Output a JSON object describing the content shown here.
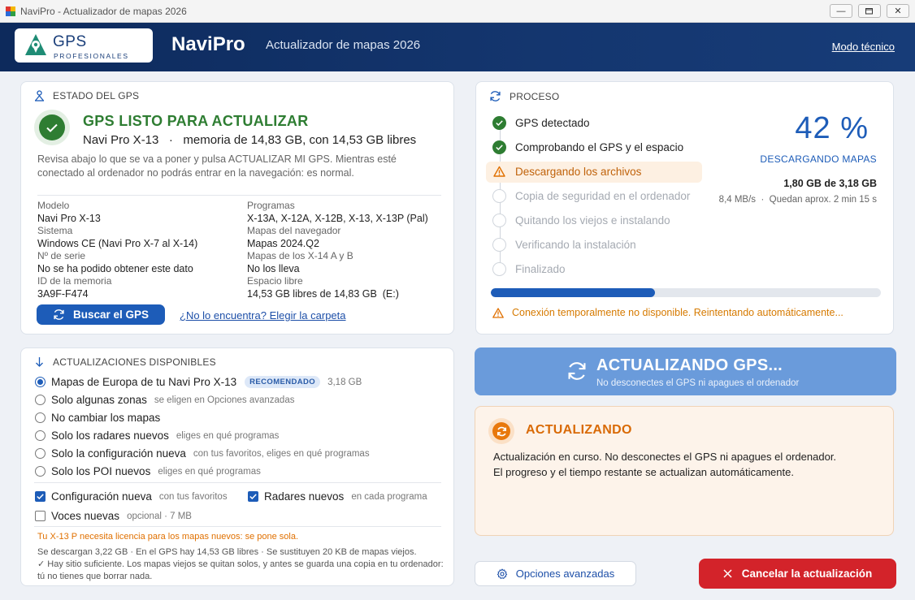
{
  "window": {
    "title": "NaviPro - Actualizador de mapas 2026"
  },
  "header": {
    "logo_main": "GPS",
    "logo_sub": "PROFESIONALES",
    "brand": "NaviPro",
    "subtitle": "Actualizador de mapas 2026",
    "modo_tecnico": "Modo técnico"
  },
  "estado": {
    "heading": "ESTADO DEL GPS",
    "ready_title": "GPS LISTO PARA ACTUALIZAR",
    "ready_sub": "Navi Pro X-13   ·   memoria de 14,83 GB, con 14,53 GB libres",
    "desc": "Revisa abajo lo que se va a poner y pulsa ACTUALIZAR MI GPS. Mientras esté conectado al ordenador no podrás entrar en la navegación: es normal.",
    "specs_left": [
      {
        "label": "Modelo",
        "value": "Navi Pro X-13"
      },
      {
        "label": "Sistema",
        "value": "Windows CE (Navi Pro X-7 al X-14)"
      },
      {
        "label": "Nº de serie",
        "value": "No se ha podido obtener este dato"
      },
      {
        "label": "ID de la memoria",
        "value": "3A9F-F474"
      }
    ],
    "specs_right": [
      {
        "label": "Programas",
        "value": "X-13A, X-12A, X-12B, X-13, X-13P (Pal)"
      },
      {
        "label": "Mapas del navegador",
        "value": "Mapas 2024.Q2"
      },
      {
        "label": "Mapas de los X-14 A y B",
        "value": "No los lleva"
      },
      {
        "label": "Espacio libre",
        "value": "14,53 GB libres de 14,83 GB  (E:)"
      }
    ],
    "search_button": "Buscar el GPS",
    "folder_link": "¿No lo encuentra? Elegir la carpeta"
  },
  "actualizaciones": {
    "heading": "ACTUALIZACIONES DISPONIBLES",
    "options": [
      {
        "label": "Mapas de Europa de tu Navi Pro X-13",
        "badge": "RECOMENDADO",
        "hint": "3,18 GB",
        "selected": true
      },
      {
        "label": "Solo algunas zonas",
        "hint": "se eligen en Opciones avanzadas",
        "selected": false
      },
      {
        "label": "No cambiar los mapas",
        "hint": "",
        "selected": false
      },
      {
        "label": "Solo los radares nuevos",
        "hint": "eliges en qué programas",
        "selected": false
      },
      {
        "label": "Solo la configuración nueva",
        "hint": "con tus favoritos, eliges en qué programas",
        "selected": false
      },
      {
        "label": "Solo los POI nuevos",
        "hint": "eliges en qué programas",
        "selected": false
      }
    ],
    "checks": [
      {
        "label": "Configuración nueva",
        "hint": "con tus favoritos",
        "checked": true
      },
      {
        "label": "Radares nuevos",
        "hint": "en cada programa",
        "checked": true
      },
      {
        "label": "Voces nuevas",
        "hint": "opcional · 7 MB",
        "checked": false
      }
    ],
    "license_warning": "Tu X-13 P necesita licencia para los mapas nuevos: se pone sola.",
    "info_line1": "Se descargan 3,22 GB · En el GPS hay 14,53 GB libres · Se sustituyen 20 KB de mapas viejos.",
    "info_line2": "✓ Hay sitio suficiente. Los mapas viejos se quitan solos, y antes se guarda una copia en tu ordenador: tú no tienes que borrar nada."
  },
  "proceso": {
    "heading": "PROCESO",
    "steps": [
      {
        "label": "GPS detectado",
        "state": "done"
      },
      {
        "label": "Comprobando el GPS y el espacio",
        "state": "done"
      },
      {
        "label": "Descargando los archivos",
        "state": "current"
      },
      {
        "label": "Copia de seguridad en el ordenador",
        "state": "pending"
      },
      {
        "label": "Quitando los viejos e instalando",
        "state": "pending"
      },
      {
        "label": "Verificando la instalación",
        "state": "pending"
      },
      {
        "label": "Finalizado",
        "state": "pending"
      }
    ],
    "percent_text": "42 %",
    "percent": 42,
    "status_label": "DESCARGANDO MAPAS",
    "gb_text": "1,80 GB de 3,18 GB",
    "speed_text": "8,4 MB/s  ·  Quedan aprox. 2 min 15 s",
    "connection_warning": "Conexión temporalmente no disponible. Reintentando automáticamente..."
  },
  "banner": {
    "title": "ACTUALIZANDO GPS...",
    "sub": "No desconectes el GPS ni apagues el ordenador"
  },
  "updating": {
    "title": "ACTUALIZANDO",
    "line1": "Actualización en curso. No desconectes el GPS ni apagues el ordenador.",
    "line2": "El progreso y el tiempo restante se actualizan automáticamente."
  },
  "footer": {
    "advanced_button": "Opciones avanzadas",
    "cancel_button": "Cancelar la actualización"
  },
  "colors": {
    "accent": "#1d5cb8",
    "success": "#2e7d32",
    "warning": "#e07000",
    "danger": "#d3232a"
  }
}
